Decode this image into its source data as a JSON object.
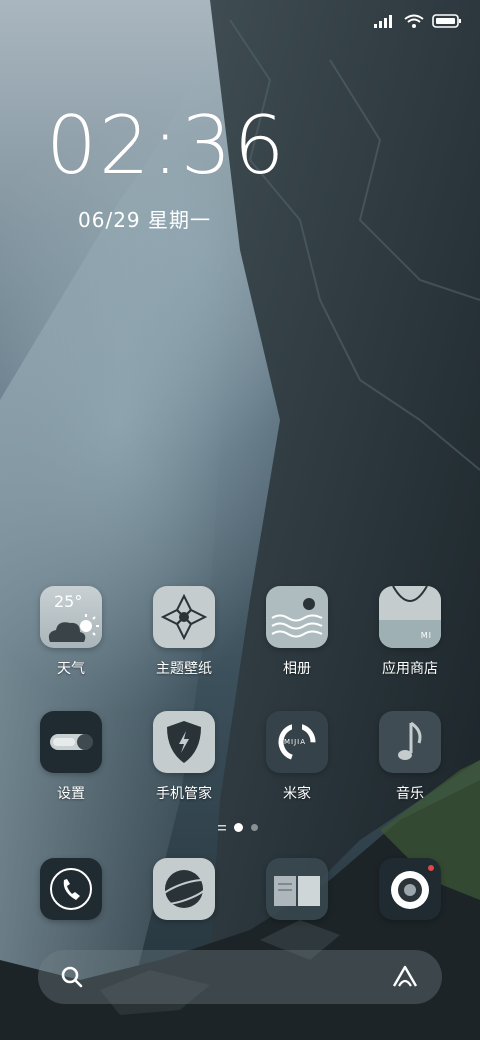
{
  "status_bar": {
    "icons": [
      "signal-icon",
      "wifi-icon",
      "battery-icon"
    ]
  },
  "lock_clock": {
    "time": "02:36",
    "date": "06/29 星期一"
  },
  "home_rows": [
    [
      {
        "name": "weather",
        "label": "天气",
        "icon_text": "25°"
      },
      {
        "name": "themes",
        "label": "主题壁纸"
      },
      {
        "name": "gallery",
        "label": "相册"
      },
      {
        "name": "app-store",
        "label": "应用商店",
        "icon_text": "MI"
      }
    ],
    [
      {
        "name": "settings",
        "label": "设置"
      },
      {
        "name": "security",
        "label": "手机管家"
      },
      {
        "name": "mi-home",
        "label": "米家",
        "icon_text": "MIJIA"
      },
      {
        "name": "music",
        "label": "音乐"
      }
    ]
  ],
  "page_indicator": {
    "pages": 2,
    "current": 1
  },
  "dock": [
    {
      "name": "phone"
    },
    {
      "name": "browser"
    },
    {
      "name": "messages"
    },
    {
      "name": "camera"
    }
  ],
  "search": {
    "left_icon": "search-icon",
    "right_icon": "assistant-icon"
  },
  "colors": {
    "icon_light": "#c4ccce",
    "icon_dark": "#1f2b31",
    "camera_dot": "#e04848"
  }
}
